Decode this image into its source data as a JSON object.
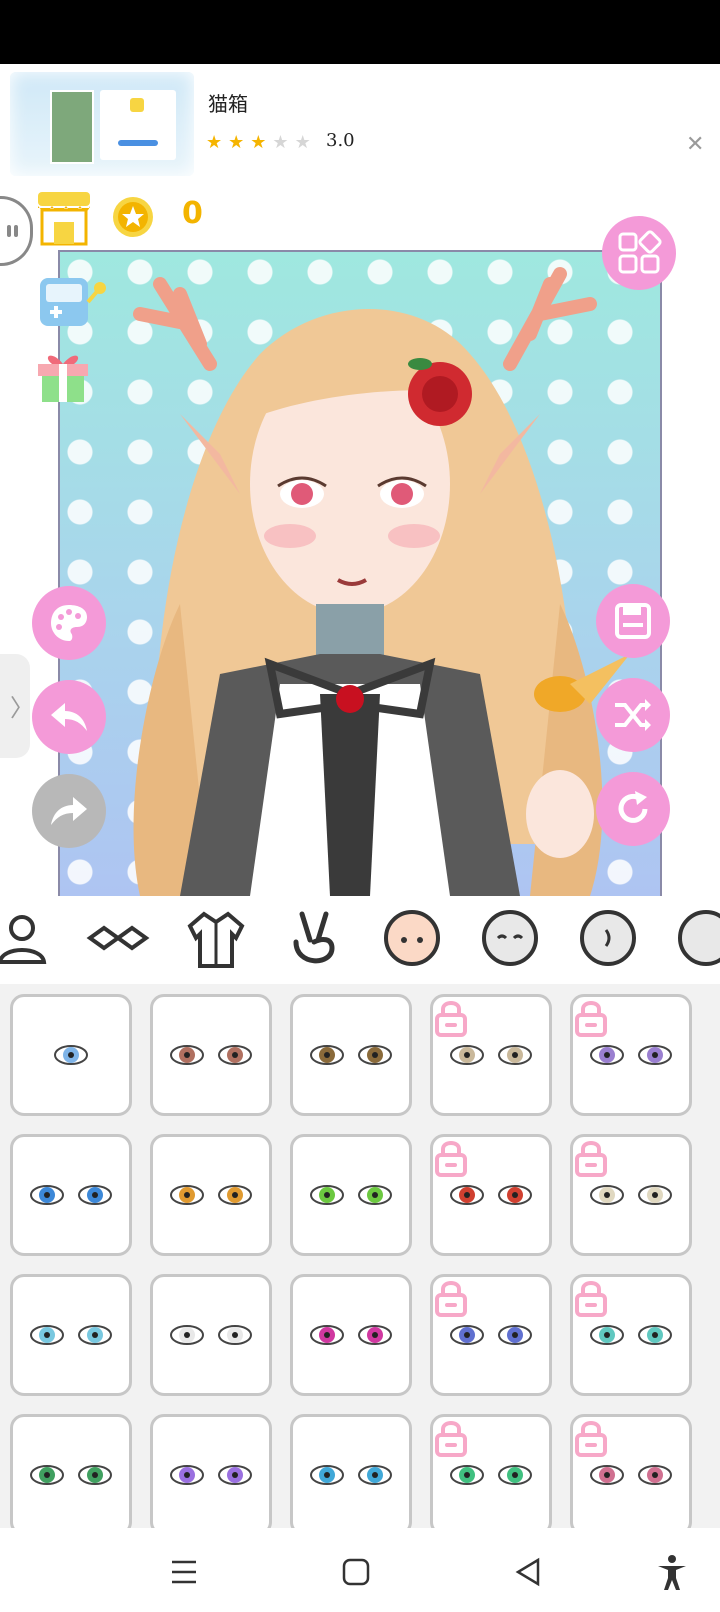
{
  "ad": {
    "title": "猫箱",
    "rating": "3.0",
    "stars": [
      "on",
      "on",
      "on",
      "off",
      "off"
    ],
    "close_icon": "close-icon"
  },
  "toolbar": {
    "coin_count": "0"
  },
  "colors": {
    "accent_pink": "#f49ad8",
    "coin_yellow": "#f3b400",
    "disabled_gray": "#b8b8b8"
  },
  "tabs": [
    {
      "name": "profile-tab",
      "icon": "person-icon"
    },
    {
      "name": "glasses-tab",
      "icon": "mask-icon"
    },
    {
      "name": "clothes-tab",
      "icon": "shirt-icon"
    },
    {
      "name": "pose-tab",
      "icon": "peace-hand-icon"
    },
    {
      "name": "eyes-tab",
      "icon": "face-icon",
      "selected": true
    },
    {
      "name": "face-tab",
      "icon": "face-outline-icon"
    },
    {
      "name": "ear-tab",
      "icon": "head-side-icon"
    },
    {
      "name": "head-tab",
      "icon": "head-icon"
    }
  ],
  "items": [
    {
      "iris": "#7fb4e8",
      "locked": false,
      "style": "single"
    },
    {
      "iris": "#b07060",
      "locked": false
    },
    {
      "iris": "#8a6a3a",
      "locked": false
    },
    {
      "iris": "#c9b89a",
      "locked": true
    },
    {
      "iris": "#9a7fd0",
      "locked": true
    },
    {
      "iris": "#3c88d8",
      "locked": false
    },
    {
      "iris": "#e09a30",
      "locked": false
    },
    {
      "iris": "#6cc840",
      "locked": false
    },
    {
      "iris": "#d04030",
      "locked": true
    },
    {
      "iris": "#e0d8c0",
      "locked": true
    },
    {
      "iris": "#78c8e0",
      "locked": false
    },
    {
      "iris": "#e8e8e8",
      "locked": false
    },
    {
      "iris": "#d038a0",
      "locked": false
    },
    {
      "iris": "#6070d0",
      "locked": true
    },
    {
      "iris": "#60c8c0",
      "locked": true
    },
    {
      "iris": "#40a060",
      "locked": false
    },
    {
      "iris": "#9a70e0",
      "locked": false
    },
    {
      "iris": "#40a8d8",
      "locked": false
    },
    {
      "iris": "#40c080",
      "locked": true
    },
    {
      "iris": "#d07090",
      "locked": true
    }
  ],
  "navbar": [
    "menu-icon",
    "home-square-icon",
    "back-triangle-icon",
    "accessibility-icon"
  ]
}
